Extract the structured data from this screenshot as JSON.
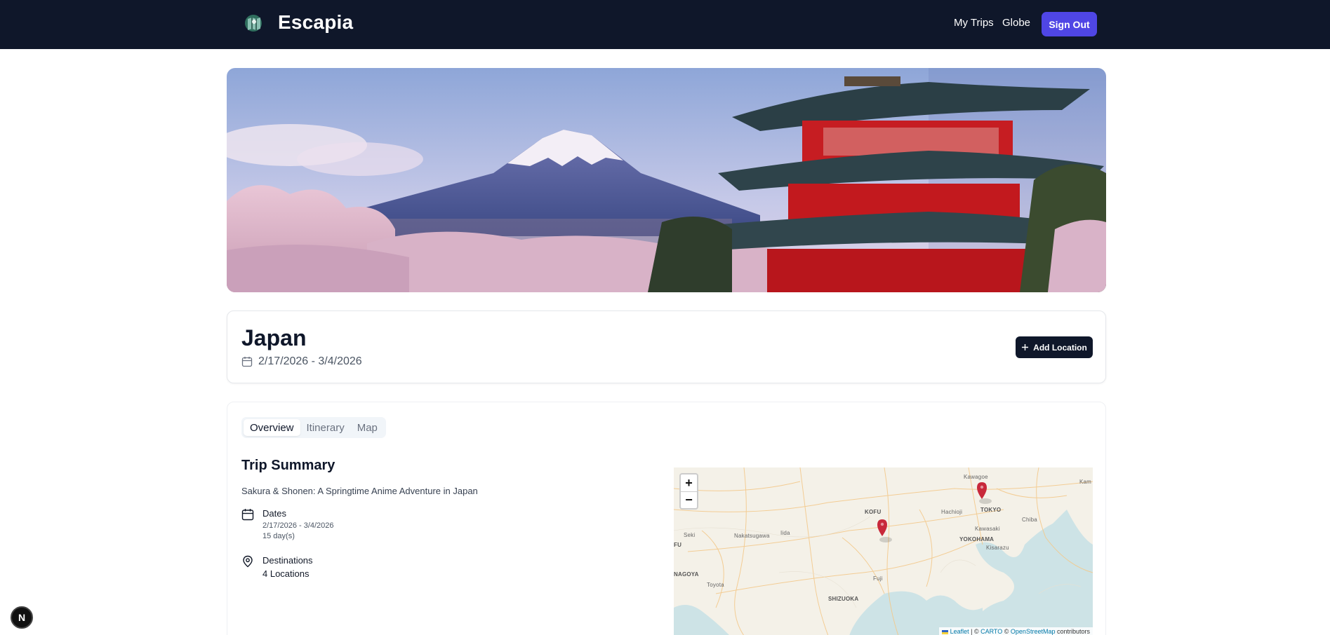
{
  "nav": {
    "brand": "Escapia",
    "links": [
      "My Trips",
      "Globe"
    ],
    "sign_out": "Sign Out"
  },
  "trip": {
    "title": "Japan",
    "dates": "2/17/2026 - 3/4/2026",
    "add_location": "Add Location"
  },
  "tabs": [
    "Overview",
    "Itinerary",
    "Map"
  ],
  "summary": {
    "title": "Trip Summary",
    "subtitle": "Sakura & Shonen: A Springtime Anime Adventure in Japan",
    "dates_label": "Dates",
    "dates_value": "2/17/2026 - 3/4/2026",
    "duration": "15 day(s)",
    "destinations_label": "Destinations",
    "destinations_value": "4 Locations"
  },
  "map": {
    "zoom_in": "+",
    "zoom_out": "−",
    "attribution_leaflet": "Leaflet",
    "attribution_sep1": " | © ",
    "attribution_carto": "CARTO",
    "attribution_sep2": " © ",
    "attribution_osm": "OpenStreetMap",
    "attribution_tail": " contributors",
    "labels": {
      "kawagoe": "Kawagoe",
      "tokyo": "TOKYO",
      "kam": "Kam",
      "kofu": "KOFU",
      "hachioji": "Hachioji",
      "chiba": "Chiba",
      "seki": "Seki",
      "nakatsugawa": "Nakatsugawa",
      "iida": "Iida",
      "kawasaki": "Kawasaki",
      "yokohama": "YOKOHAMA",
      "fu": "FU",
      "kisarazu": "Kisarazu",
      "nagoya": "NAGOYA",
      "toyota": "Toyota",
      "fuji": "Fuji",
      "shizuoka": "SHIZUOKA"
    }
  },
  "dev_badge": "N"
}
